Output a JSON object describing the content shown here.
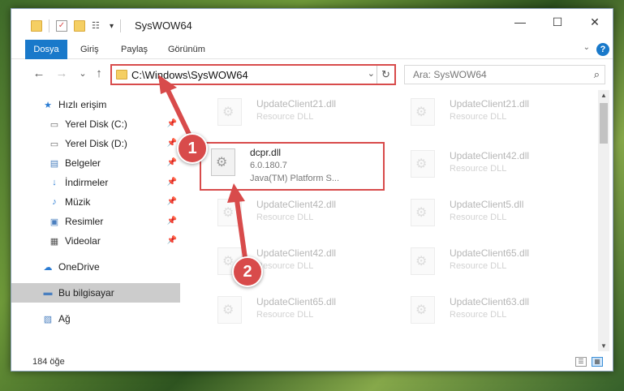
{
  "window": {
    "title": "SysWOW64",
    "controls": {
      "minimize": "—",
      "maximize": "☐",
      "close": "✕"
    }
  },
  "ribbon": {
    "tabs": [
      "Dosya",
      "Giriş",
      "Paylaş",
      "Görünüm"
    ],
    "help": "?"
  },
  "nav": {
    "back": "←",
    "forward": "→",
    "recent": "⌄",
    "up": "↑",
    "address": "C:\\Windows\\SysWOW64",
    "refresh": "↻",
    "dropdown": "⌄",
    "search_placeholder": "Ara: SysWOW64",
    "search_icon": "⌕"
  },
  "sidebar": {
    "items": [
      {
        "label": "Hızlı erişim",
        "icon": "star-icon",
        "glyph": "★",
        "color": "#2b7cd3",
        "pinned": false
      },
      {
        "label": "Yerel Disk (C:)",
        "icon": "drive-icon",
        "glyph": "▭",
        "color": "#666",
        "pinned": true
      },
      {
        "label": "Yerel Disk (D:)",
        "icon": "drive-icon",
        "glyph": "▭",
        "color": "#666",
        "pinned": true
      },
      {
        "label": "Belgeler",
        "icon": "documents-icon",
        "glyph": "▤",
        "color": "#4a7fbf",
        "pinned": true
      },
      {
        "label": "İndirmeler",
        "icon": "download-icon",
        "glyph": "↓",
        "color": "#2b7cd3",
        "pinned": true
      },
      {
        "label": "Müzik",
        "icon": "music-icon",
        "glyph": "♪",
        "color": "#2b7cd3",
        "pinned": true
      },
      {
        "label": "Resimler",
        "icon": "pictures-icon",
        "glyph": "▣",
        "color": "#4a7fbf",
        "pinned": true
      },
      {
        "label": "Videolar",
        "icon": "video-icon",
        "glyph": "▦",
        "color": "#555",
        "pinned": true
      },
      {
        "label": "OneDrive",
        "icon": "cloud-icon",
        "glyph": "☁",
        "color": "#2b7cd3",
        "pinned": false
      },
      {
        "label": "Bu bilgisayar",
        "icon": "computer-icon",
        "glyph": "▬",
        "color": "#4a7fbf",
        "pinned": false,
        "selected": true
      },
      {
        "label": "Ağ",
        "icon": "network-icon",
        "glyph": "▧",
        "color": "#4a7fbf",
        "pinned": false
      }
    ],
    "pin_glyph": "📌"
  },
  "files": {
    "col1": [
      {
        "name": "UpdateClient21.dll",
        "line2": "Resource DLL",
        "line3": ""
      },
      {
        "name": "dcpr.dll",
        "line2": "6.0.180.7",
        "line3": "Java(TM) Platform S...",
        "highlight": true
      },
      {
        "name": "UpdateClient42.dll",
        "line2": "Resource DLL",
        "line3": ""
      },
      {
        "name": "UpdateClient42.dll",
        "line2": "Resource DLL",
        "line3": ""
      },
      {
        "name": "UpdateClient65.dll",
        "line2": "Resource DLL",
        "line3": ""
      }
    ],
    "col2": [
      {
        "name": "UpdateClient21.dll",
        "line2": "Resource DLL",
        "line3": ""
      },
      {
        "name": "UpdateClient42.dll",
        "line2": "Resource DLL",
        "line3": ""
      },
      {
        "name": "UpdateClient5.dll",
        "line2": "Resource DLL",
        "line3": ""
      },
      {
        "name": "UpdateClient65.dll",
        "line2": "Resource DLL",
        "line3": ""
      },
      {
        "name": "UpdateClient63.dll",
        "line2": "Resource DLL",
        "line3": ""
      }
    ]
  },
  "status": {
    "count": "184 öğe"
  },
  "annotations": {
    "badge1": "1",
    "badge2": "2",
    "color": "#d84b4b"
  }
}
